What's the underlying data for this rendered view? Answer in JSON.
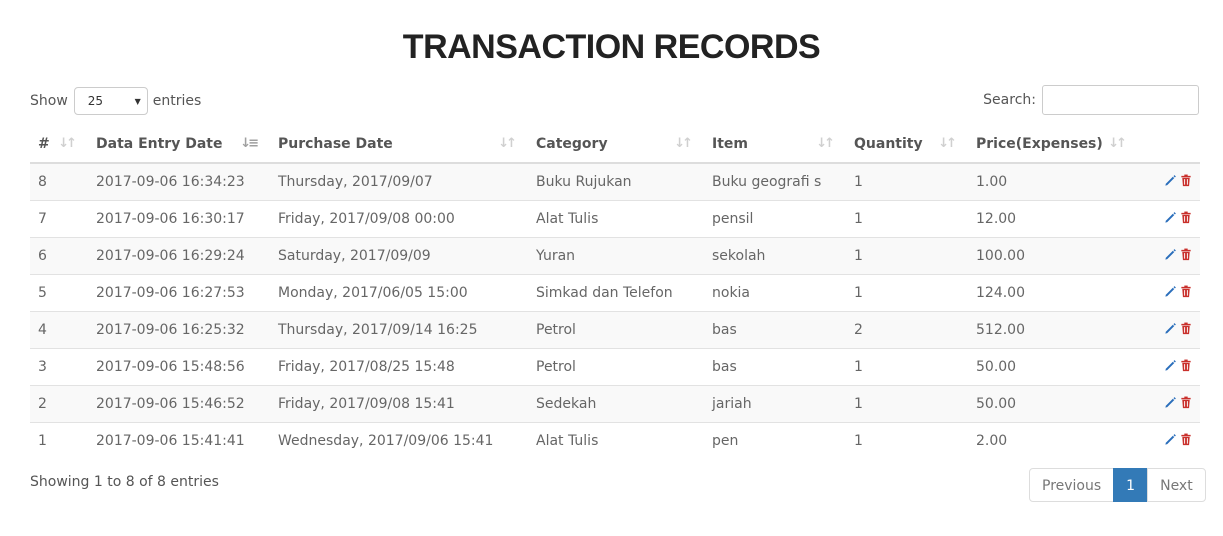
{
  "page": {
    "title": "TRANSACTION RECORDS"
  },
  "length_menu": {
    "show_label": "Show",
    "selected": "25",
    "entries_label": "entries"
  },
  "search": {
    "label": "Search:",
    "value": ""
  },
  "table": {
    "columns": [
      "#",
      "Data Entry Date",
      "Purchase Date",
      "Category",
      "Item",
      "Quantity",
      "Price(Expenses)"
    ],
    "sorted_column": "Data Entry Date",
    "rows": [
      [
        "8",
        "2017-09-06 16:34:23",
        "Thursday, 2017/09/07",
        "Buku Rujukan",
        "Buku geografi s",
        "1",
        "1.00"
      ],
      [
        "7",
        "2017-09-06 16:30:17",
        "Friday, 2017/09/08 00:00",
        "Alat Tulis",
        "pensil",
        "1",
        "12.00"
      ],
      [
        "6",
        "2017-09-06 16:29:24",
        "Saturday, 2017/09/09",
        "Yuran",
        "sekolah",
        "1",
        "100.00"
      ],
      [
        "5",
        "2017-09-06 16:27:53",
        "Monday, 2017/06/05 15:00",
        "Simkad dan Telefon",
        "nokia",
        "1",
        "124.00"
      ],
      [
        "4",
        "2017-09-06 16:25:32",
        "Thursday, 2017/09/14 16:25",
        "Petrol",
        "bas",
        "2",
        "512.00"
      ],
      [
        "3",
        "2017-09-06 15:48:56",
        "Friday, 2017/08/25 15:48",
        "Petrol",
        "bas",
        "1",
        "50.00"
      ],
      [
        "2",
        "2017-09-06 15:46:52",
        "Friday, 2017/09/08 15:41",
        "Sedekah",
        "jariah",
        "1",
        "50.00"
      ],
      [
        "1",
        "2017-09-06 15:41:41",
        "Wednesday, 2017/09/06 15:41",
        "Alat Tulis",
        "pen",
        "1",
        "2.00"
      ]
    ],
    "row_action_icons": [
      "pencil-icon",
      "trash-icon"
    ]
  },
  "footer": {
    "info": "Showing 1 to 8 of 8 entries"
  },
  "pagination": {
    "previous": "Previous",
    "current": "1",
    "next": "Next"
  },
  "colors": {
    "accent": "#337ab7",
    "edit_icon": "#2a6ebb",
    "delete_icon": "#c9302c",
    "title": "#222222"
  }
}
